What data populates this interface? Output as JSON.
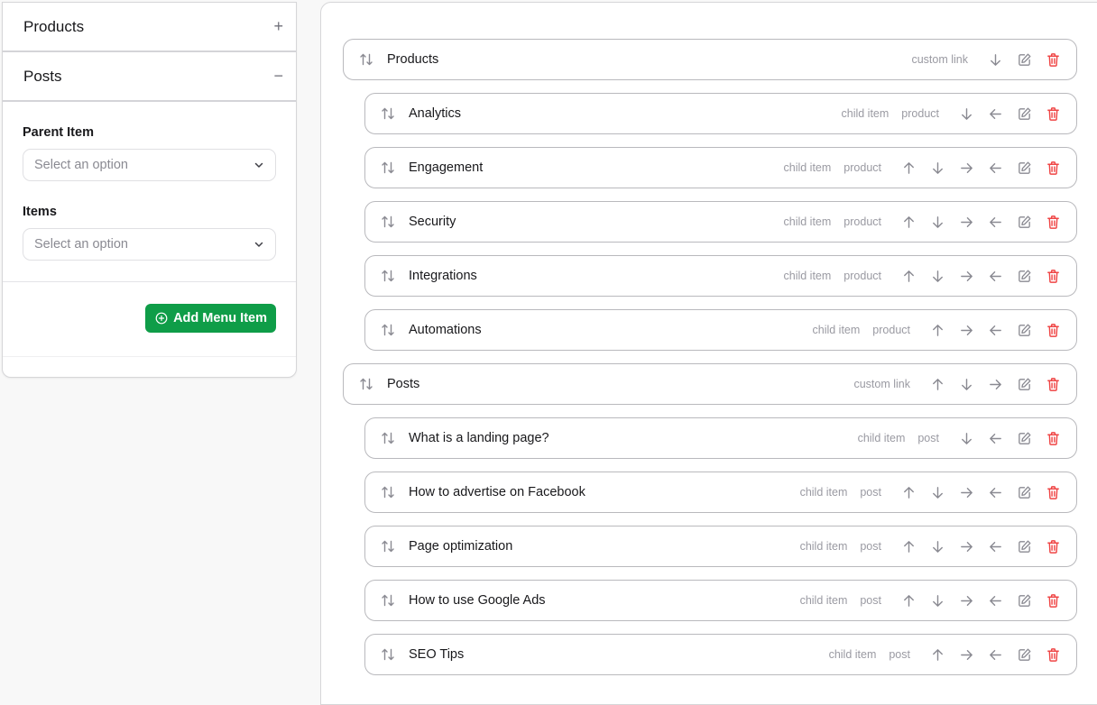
{
  "sidebar": {
    "sections": [
      {
        "title": "Products",
        "toggle": "+",
        "expanded": false
      },
      {
        "title": "Posts",
        "toggle": "−",
        "expanded": true
      }
    ],
    "form": {
      "parent_item": {
        "label": "Parent Item",
        "placeholder": "Select an option"
      },
      "items": {
        "label": "Items",
        "placeholder": "Select an option"
      },
      "add_button": "Add Menu Item"
    }
  },
  "menu": {
    "items": [
      {
        "title": "Products",
        "level": "parent",
        "tags": [
          "custom link"
        ],
        "actions": [
          "down",
          "edit",
          "delete"
        ]
      },
      {
        "title": "Analytics",
        "level": "child",
        "tags": [
          "child item",
          "product"
        ],
        "actions": [
          "down",
          "left",
          "edit",
          "delete"
        ]
      },
      {
        "title": "Engagement",
        "level": "child",
        "tags": [
          "child item",
          "product"
        ],
        "actions": [
          "up",
          "down",
          "right",
          "left",
          "edit",
          "delete"
        ]
      },
      {
        "title": "Security",
        "level": "child",
        "tags": [
          "child item",
          "product"
        ],
        "actions": [
          "up",
          "down",
          "right",
          "left",
          "edit",
          "delete"
        ]
      },
      {
        "title": "Integrations",
        "level": "child",
        "tags": [
          "child item",
          "product"
        ],
        "actions": [
          "up",
          "down",
          "right",
          "left",
          "edit",
          "delete"
        ]
      },
      {
        "title": "Automations",
        "level": "child",
        "tags": [
          "child item",
          "product"
        ],
        "actions": [
          "up",
          "right",
          "left",
          "edit",
          "delete"
        ]
      },
      {
        "title": "Posts",
        "level": "parent",
        "tags": [
          "custom link"
        ],
        "actions": [
          "up",
          "down",
          "right",
          "edit",
          "delete"
        ]
      },
      {
        "title": "What is a landing page?",
        "level": "child",
        "tags": [
          "child item",
          "post"
        ],
        "actions": [
          "down",
          "left",
          "edit",
          "delete"
        ]
      },
      {
        "title": "How to advertise on Facebook",
        "level": "child",
        "tags": [
          "child item",
          "post"
        ],
        "actions": [
          "up",
          "down",
          "right",
          "left",
          "edit",
          "delete"
        ]
      },
      {
        "title": "Page optimization",
        "level": "child",
        "tags": [
          "child item",
          "post"
        ],
        "actions": [
          "up",
          "down",
          "right",
          "left",
          "edit",
          "delete"
        ]
      },
      {
        "title": "How to use Google Ads",
        "level": "child",
        "tags": [
          "child item",
          "post"
        ],
        "actions": [
          "up",
          "down",
          "right",
          "left",
          "edit",
          "delete"
        ]
      },
      {
        "title": "SEO Tips",
        "level": "child",
        "tags": [
          "child item",
          "post"
        ],
        "actions": [
          "up",
          "right",
          "left",
          "edit",
          "delete"
        ]
      }
    ]
  },
  "colors": {
    "accent_green": "#0f9d48",
    "delete_red": "#ef4444",
    "icon_gray": "#8a8a92"
  }
}
